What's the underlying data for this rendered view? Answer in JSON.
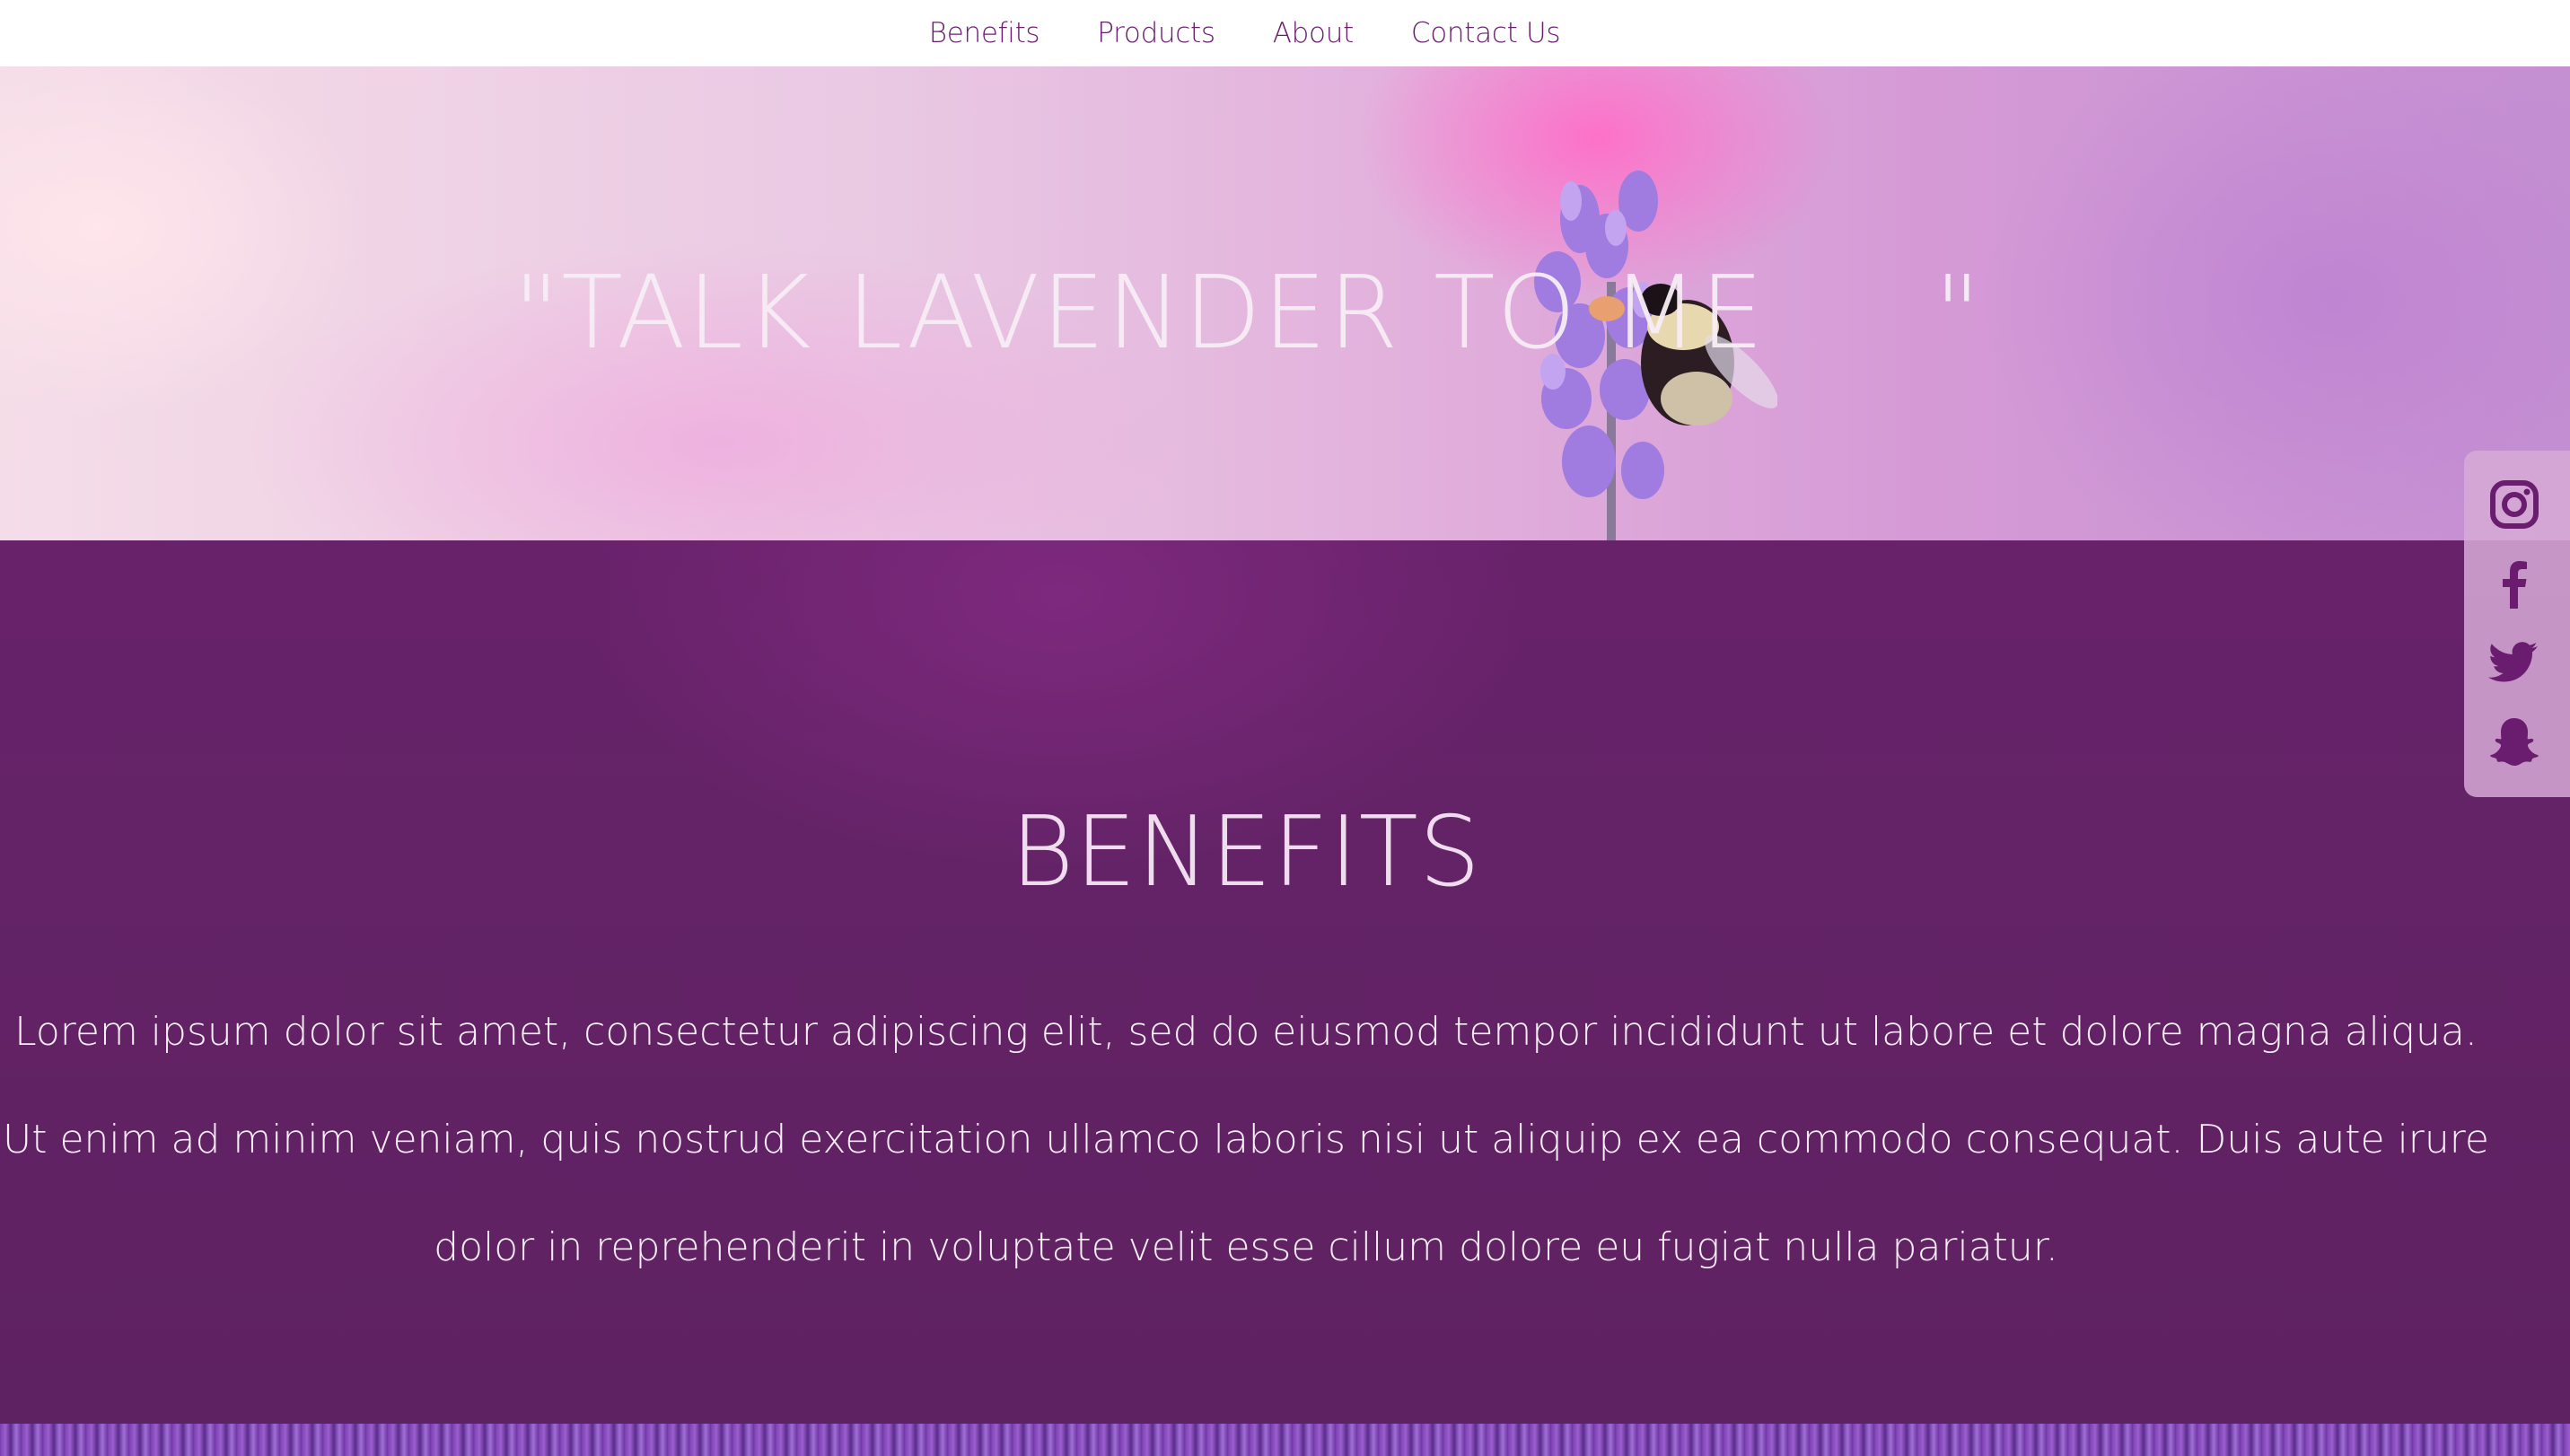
{
  "nav": {
    "items": [
      {
        "label": "Benefits"
      },
      {
        "label": "Products"
      },
      {
        "label": "About"
      },
      {
        "label": "Contact Us"
      }
    ],
    "link_color": "#6a1d6e"
  },
  "hero": {
    "title": "\"TALK LAVENDER TO ME     \""
  },
  "benefits": {
    "title": "BENEFITS",
    "body": "Lorem ipsum dolor sit amet, consectetur adipiscing elit, sed do eiusmod tempor incididunt ut labore et dolore magna aliqua. Ut enim ad minim veniam, quis nostrud exercitation ullamco laboris nisi ut aliquip ex ea commodo consequat. Duis aute irure dolor in reprehenderit in voluptate velit esse cillum dolore eu fugiat nulla pariatur.",
    "background_color": "#5e2161"
  },
  "social": {
    "icons": [
      "instagram-icon",
      "facebook-icon",
      "twitter-icon",
      "snapchat-icon"
    ],
    "icon_color": "#6a1d6e"
  }
}
